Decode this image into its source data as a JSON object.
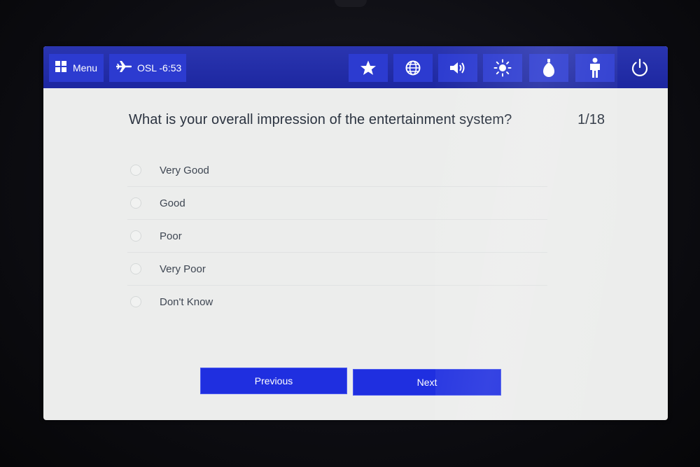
{
  "topbar": {
    "menu_label": "Menu",
    "flight_label": "OSL -6:53",
    "icons": [
      "grid-icon",
      "airplane-icon",
      "star-icon",
      "globe-icon",
      "volume-icon",
      "brightness-icon",
      "light-bulb-icon",
      "attendant-call-icon",
      "power-icon"
    ]
  },
  "survey": {
    "question": "What is your overall impression of the entertainment system?",
    "counter": "1/18",
    "options": [
      {
        "label": "Very Good"
      },
      {
        "label": "Good"
      },
      {
        "label": "Poor"
      },
      {
        "label": "Very Poor"
      },
      {
        "label": "Don't Know"
      }
    ],
    "previous_label": "Previous",
    "next_label": "Next"
  },
  "colors": {
    "topbar": "#1d27a0",
    "button": "#1f2fe0",
    "screen_bg": "#ecedec",
    "text": "#2b3340"
  }
}
